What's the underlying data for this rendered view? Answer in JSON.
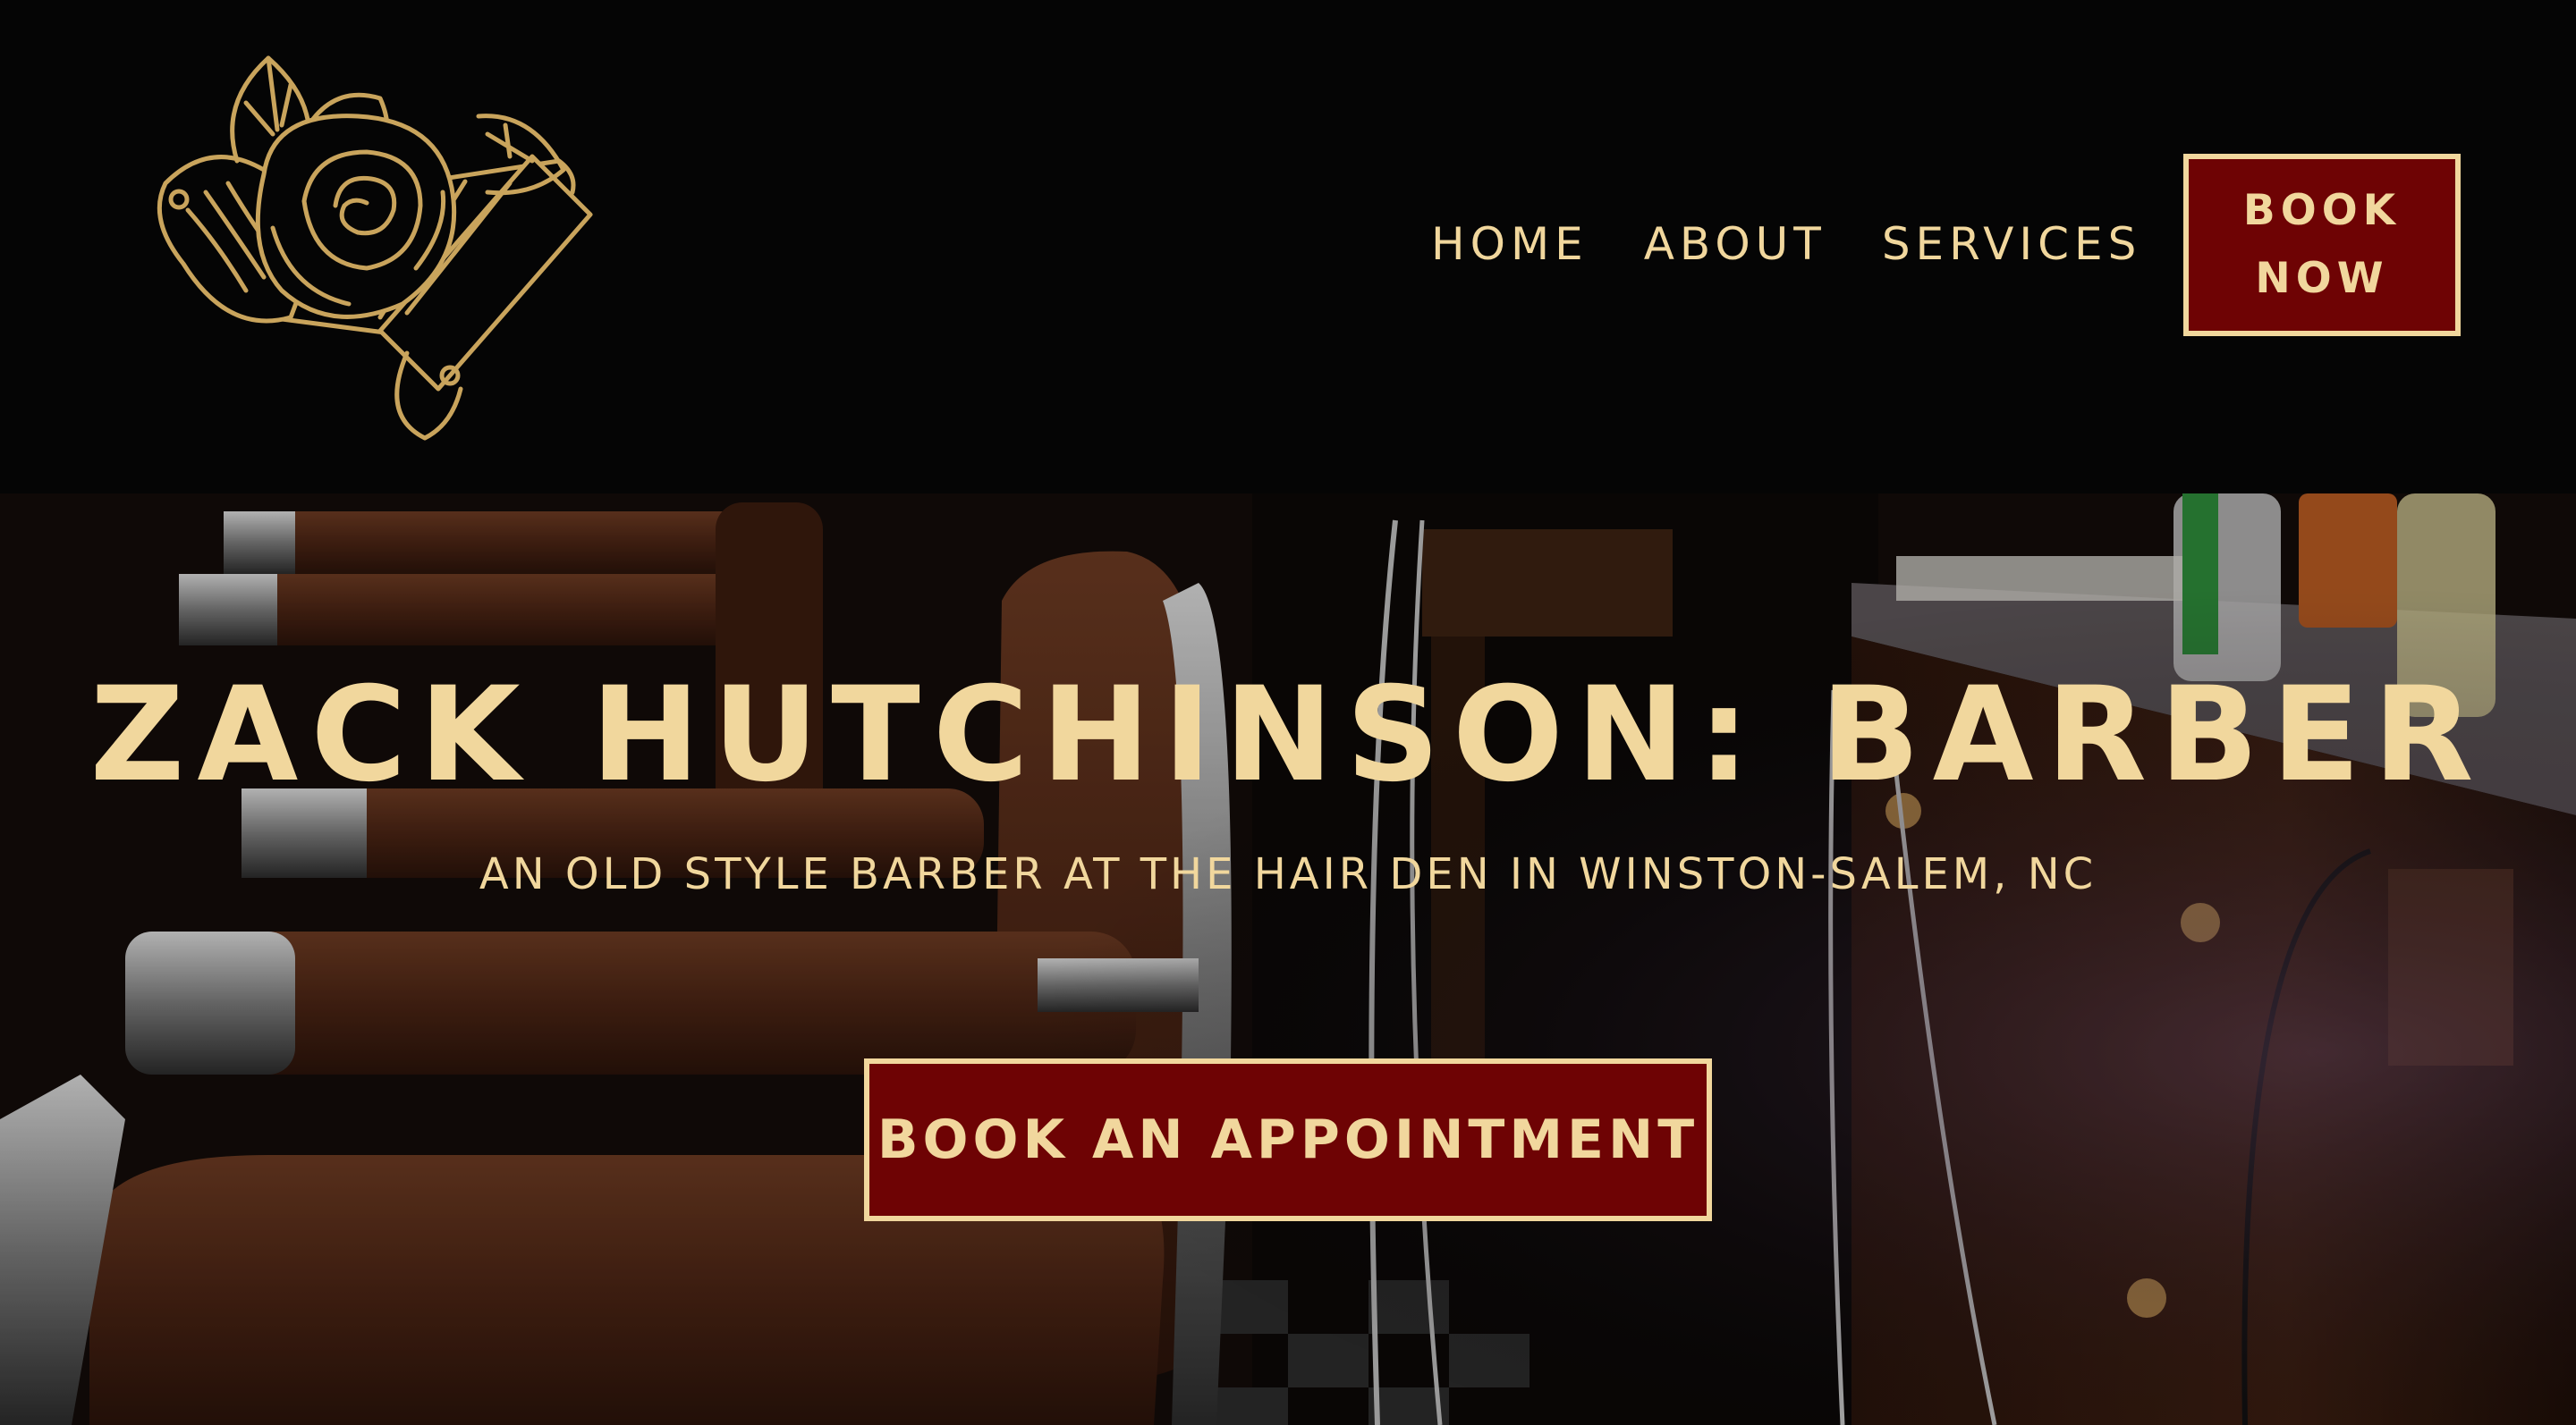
{
  "brand": {
    "logo_icon": "rose-straight-razor-logo",
    "accent_color": "#f1d79d",
    "button_color": "#6e0304",
    "background_color": "#050505"
  },
  "nav": {
    "items": [
      {
        "label": "HOME"
      },
      {
        "label": "ABOUT"
      },
      {
        "label": "SERVICES"
      }
    ],
    "book_now": {
      "line1": "BOOK",
      "line2": "NOW"
    }
  },
  "hero": {
    "title": "ZACK HUTCHINSON: BARBER",
    "subtitle": "AN OLD STYLE BARBER AT THE HAIR DEN IN WINSTON-SALEM, NC",
    "cta_label": "BOOK AN APPOINTMENT",
    "background_icon": "barbershop-chair-photo"
  }
}
